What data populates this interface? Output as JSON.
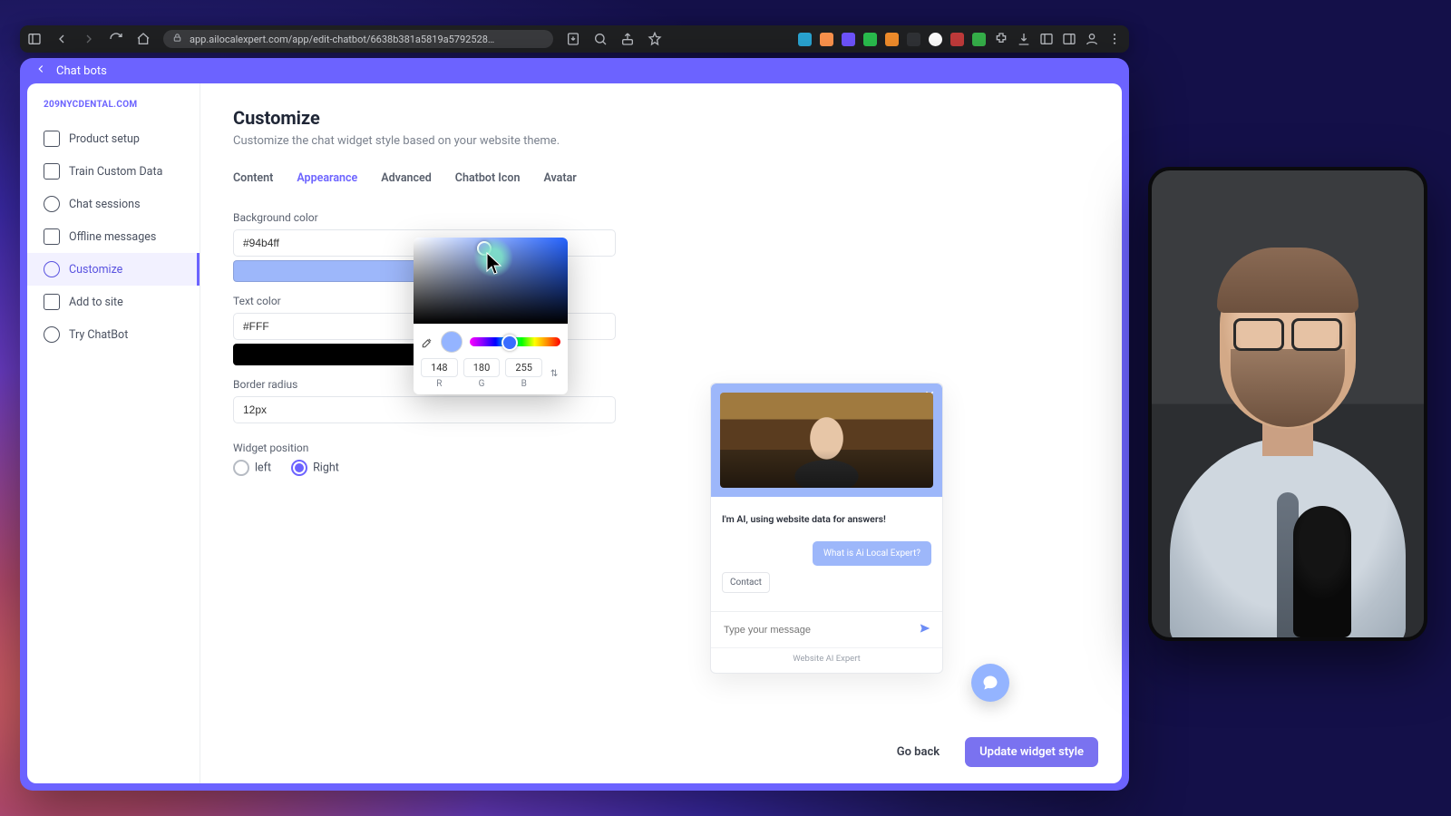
{
  "browser": {
    "url_display": "app.ailocalexpert.com/app/edit-chatbot/6638b381a5819a5792528…"
  },
  "header": {
    "back_label": "Chat bots"
  },
  "sidebar": {
    "brand": "209NYCDENTAL.COM",
    "items": [
      {
        "label": "Product setup"
      },
      {
        "label": "Train Custom Data"
      },
      {
        "label": "Chat sessions"
      },
      {
        "label": "Offline messages"
      },
      {
        "label": "Customize"
      },
      {
        "label": "Add to site"
      },
      {
        "label": "Try ChatBot"
      }
    ]
  },
  "page": {
    "title": "Customize",
    "subtitle": "Customize the chat widget style based on your website theme.",
    "tabs": [
      "Content",
      "Appearance",
      "Advanced",
      "Chatbot Icon",
      "Avatar"
    ],
    "active_tab": "Appearance"
  },
  "form": {
    "bg_label": "Background color",
    "bg_value": "#94b4ff",
    "text_label": "Text color",
    "text_value": "#FFF",
    "radius_label": "Border radius",
    "radius_value": "12px",
    "position_label": "Widget position",
    "pos_left": "left",
    "pos_right": "Right",
    "pos_selected": "Right"
  },
  "picker": {
    "swatch_big_color": "#9db7fa",
    "swatch_black": "#000000",
    "r": "148",
    "g": "180",
    "b": "255",
    "r_label": "R",
    "g_label": "G",
    "b_label": "B",
    "toggle_glyph": "⇅"
  },
  "preview": {
    "ai_line": "I'm AI, using website data for answers!",
    "chip": "What is Ai Local Expert?",
    "contact": "Contact",
    "placeholder": "Type your message",
    "footer": "Website AI Expert"
  },
  "footer": {
    "back": "Go back",
    "update": "Update widget style"
  },
  "colors": {
    "accent": "#6c63ff",
    "widget_bg": "#94b4ff"
  }
}
